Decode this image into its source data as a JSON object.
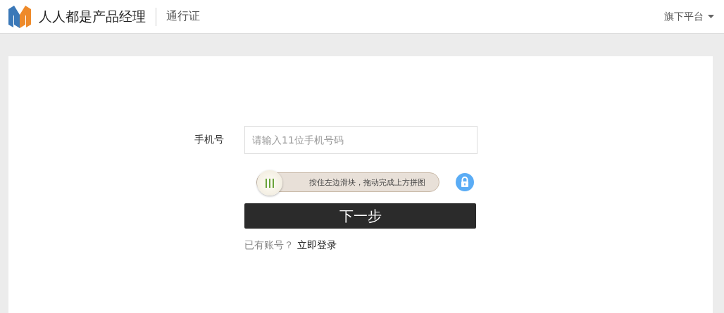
{
  "header": {
    "brand": "人人都是产品经理",
    "section": "通行证",
    "menu": "旗下平台"
  },
  "form": {
    "phone_label": "手机号",
    "phone_placeholder": "请输入11位手机号码",
    "slider": {
      "hint": "按住左边滑块，拖动完成上方拼图"
    },
    "submit": "下一步",
    "account_prompt": "已有账号？",
    "login_link": "立即登录"
  }
}
